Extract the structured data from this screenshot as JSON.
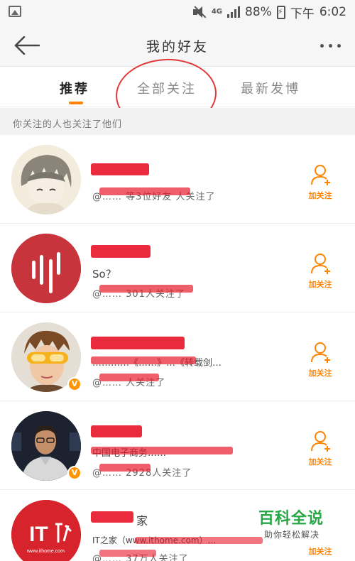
{
  "status_bar": {
    "network": "4G",
    "battery": "88%",
    "time_period": "下午",
    "time": "6:02"
  },
  "title_bar": {
    "title": "我的好友"
  },
  "tabs": [
    {
      "label": "推荐",
      "active": true
    },
    {
      "label": "全部关注",
      "active": false
    },
    {
      "label": "最新发博",
      "active": false
    }
  ],
  "section_header": "你关注的人也关注了他们",
  "colors": {
    "accent": "#ff8200",
    "annotation": "#e23a3a",
    "redaction": "#e8192c"
  },
  "users": [
    {
      "avatar_icon": "anime-boy-avatar-icon",
      "verified": false,
      "bio": "",
      "meta": "@…… 等3位好友 人关注了",
      "follow_label": "加关注"
    },
    {
      "avatar_icon": "red-bars-logo-avatar-icon",
      "verified": false,
      "bio": "So？",
      "meta": "@…… 301人关注了",
      "follow_label": "加关注"
    },
    {
      "avatar_icon": "goggles-character-avatar-icon",
      "verified": true,
      "bio": "…………《……》…《转载剑…",
      "meta": "@…… 人关注了",
      "follow_label": "加关注"
    },
    {
      "avatar_icon": "speaker-portrait-avatar-icon",
      "verified": true,
      "bio": "中国电子商务……",
      "meta": "@…… 2928人关注了",
      "follow_label": "加关注"
    },
    {
      "avatar_icon": "ithome-logo-avatar-icon",
      "verified": true,
      "name_suffix": "家",
      "bio": "IT之家（www.ithome.com）…",
      "meta": "@…… 37万人关注了",
      "follow_label": "加关注",
      "avatar_text": "IT",
      "avatar_caption": "www.ithome.com"
    }
  ],
  "watermark": {
    "title": "百科全说",
    "subtitle": "助你轻松解决"
  }
}
